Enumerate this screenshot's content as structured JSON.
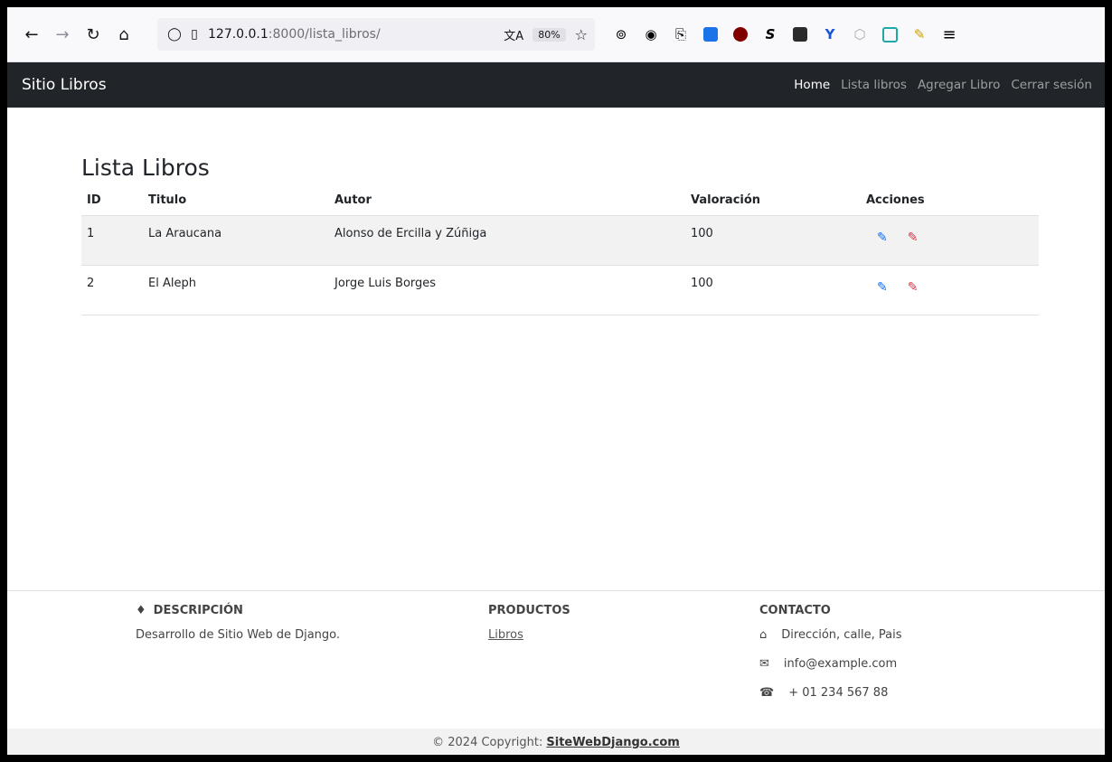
{
  "browser": {
    "url_host": "127.0.0.1",
    "url_path": ":8000/lista_libros/",
    "zoom": "80%"
  },
  "navbar": {
    "brand": "Sitio Libros",
    "links": [
      "Home",
      "Lista libros",
      "Agregar Libro",
      "Cerrar sesión"
    ]
  },
  "page": {
    "title": "Lista Libros",
    "table": {
      "headers": [
        "ID",
        "Titulo",
        "Autor",
        "Valoración",
        "Acciones"
      ],
      "rows": [
        {
          "id": "1",
          "titulo": "La Araucana",
          "autor": "Alonso de Ercilla y Zúñiga",
          "valoracion": "100"
        },
        {
          "id": "2",
          "titulo": "El Aleph",
          "autor": "Jorge Luis Borges",
          "valoracion": "100"
        }
      ]
    }
  },
  "footer": {
    "descripcion": {
      "heading": "DESCRIPCIÓN",
      "text": "Desarrollo de Sitio Web de Django."
    },
    "productos": {
      "heading": "PRODUCTOS",
      "link": "Libros"
    },
    "contacto": {
      "heading": "CONTACTO",
      "address": "Dirección, calle, Pais",
      "email": "info@example.com",
      "phone": "+ 01 234 567 88"
    },
    "copyright_prefix": "© 2024 Copyright:",
    "copyright_site": "SiteWebDjango.com"
  },
  "colors": {
    "navbar_bg": "#212529",
    "edit_blue": "#0d6efd",
    "edit_red": "#dc3545"
  }
}
